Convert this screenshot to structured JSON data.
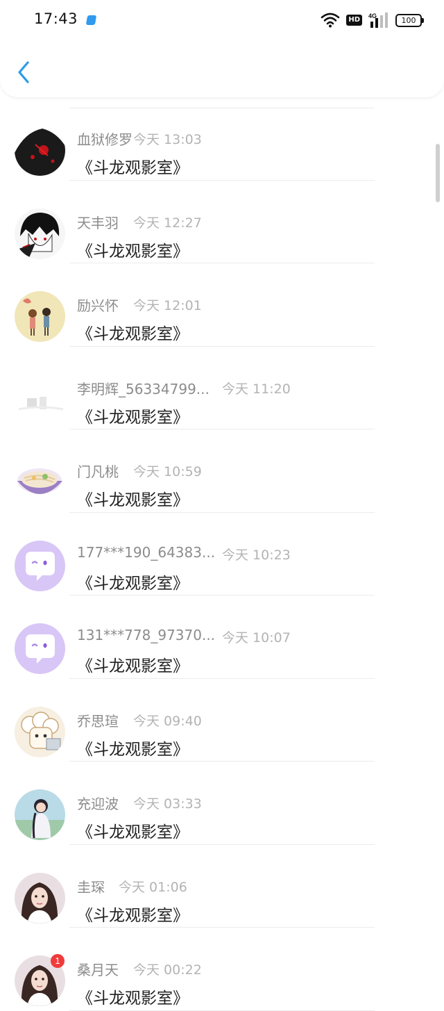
{
  "status_bar": {
    "time": "17:43",
    "network": "4G",
    "hd": "HD",
    "battery": "100"
  },
  "items": [
    {
      "name": "血狱修罗",
      "time": "今天 13:03",
      "message": "《斗龙观影室》",
      "avatar": "dark-warrior-avatar"
    },
    {
      "name": "天丰羽",
      "time": "今天 12:27",
      "message": "《斗龙观影室》",
      "avatar": "anime-boy-avatar"
    },
    {
      "name": "励兴怀",
      "time": "今天 12:01",
      "message": "《斗龙观影室》",
      "avatar": "couple-cartoon-avatar"
    },
    {
      "name": "李明辉_56334799...",
      "time": "今天 11:20",
      "message": "《斗龙观影室》",
      "avatar": "faded-image-avatar"
    },
    {
      "name": "门凡桃",
      "time": "今天 10:59",
      "message": "《斗龙观影室》",
      "avatar": "noodle-bowl-avatar"
    },
    {
      "name": "177***190_64383...",
      "time": "今天 10:23",
      "message": "《斗龙观影室》",
      "avatar": "default-chat-avatar"
    },
    {
      "name": "131***778_97370...",
      "time": "今天 10:07",
      "message": "《斗龙观影室》",
      "avatar": "default-chat-avatar"
    },
    {
      "name": "乔思瑄",
      "time": "今天 09:40",
      "message": "《斗龙观影室》",
      "avatar": "sheep-cartoon-avatar"
    },
    {
      "name": "充迎波",
      "time": "今天 03:33",
      "message": "《斗龙观影室》",
      "avatar": "girl-photo-avatar"
    },
    {
      "name": "圭琛",
      "time": "今天 01:06",
      "message": "《斗龙观影室》",
      "avatar": "woman-photo-avatar"
    },
    {
      "name": "桑月天",
      "time": "今天 00:22",
      "message": "《斗龙观影室》",
      "avatar": "woman-photo-avatar",
      "badge": "1"
    }
  ],
  "colors": {
    "accent": "#2b9be8",
    "name_text": "#8c8c8c",
    "time_text": "#b3b3b3",
    "message_text": "#222222",
    "default_avatar_bg": "#d8c6f7",
    "badge": "#f03b3b"
  }
}
